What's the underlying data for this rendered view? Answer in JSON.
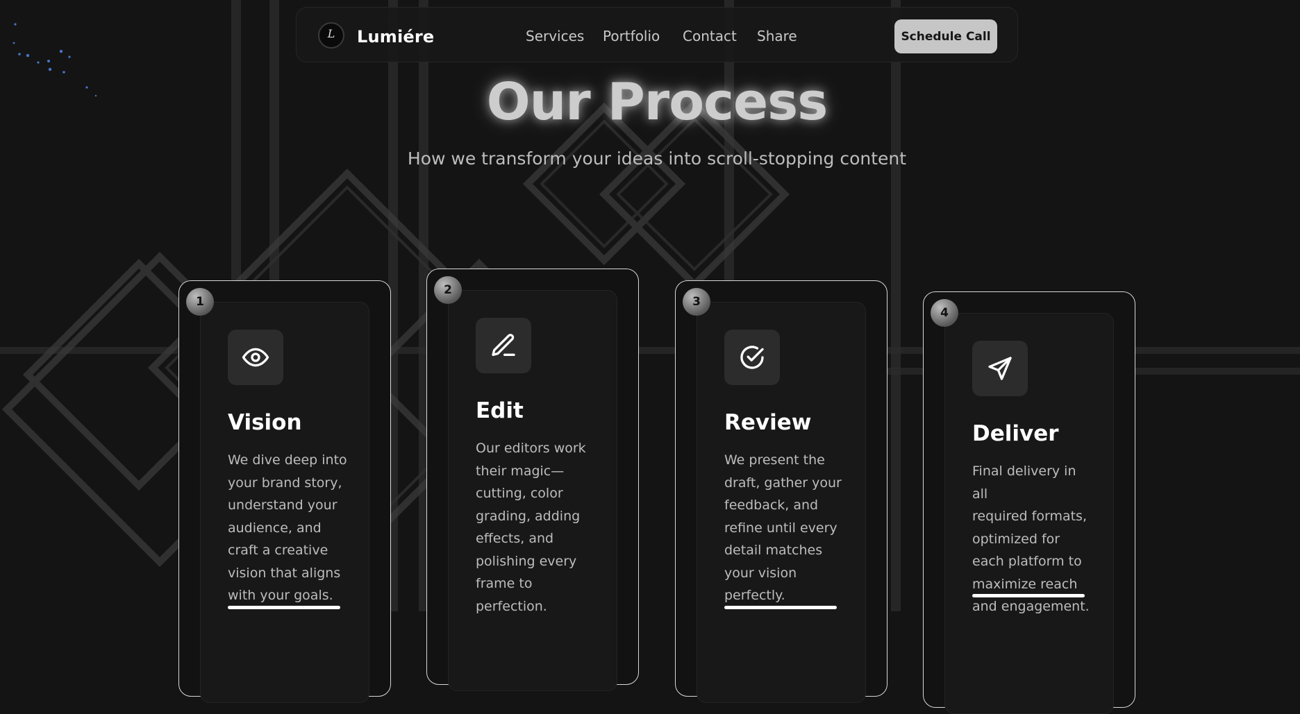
{
  "nav": {
    "brand": "Lumiére",
    "logo_glyph": "L",
    "links": [
      "Services",
      "Portfolio",
      "Contact",
      "Share"
    ],
    "cta_label": "Schedule Call"
  },
  "hero": {
    "title": "Our Process",
    "subtitle": "How we transform your ideas into scroll-stopping content"
  },
  "steps": [
    {
      "number": "1",
      "icon": "eye-icon",
      "title": "Vision",
      "lines": [
        "We dive deep into",
        "your brand story,",
        "understand your",
        "audience, and",
        "craft a creative",
        "vision that aligns",
        "with your goals."
      ]
    },
    {
      "number": "2",
      "icon": "pen-icon",
      "title": "Edit",
      "lines": [
        "Our editors work",
        "their magic—",
        "cutting, color",
        "grading, adding",
        "effects, and",
        "polishing every",
        "frame to",
        "perfection."
      ]
    },
    {
      "number": "3",
      "icon": "check-circle-icon",
      "title": "Review",
      "lines": [
        "We present the",
        "draft, gather your",
        "feedback, and",
        "refine until every",
        "detail matches",
        "your vision",
        "perfectly."
      ]
    },
    {
      "number": "4",
      "icon": "send-icon",
      "title": "Deliver",
      "lines": [
        "Final delivery in all",
        "required formats,",
        "optimized for",
        "each platform to",
        "maximize reach",
        "and engagement."
      ]
    }
  ],
  "colors": {
    "background": "#141414",
    "card_border": "#d9d9d9",
    "cta_bg": "#c6c6c6",
    "accent_glow": "#4a74c9"
  }
}
